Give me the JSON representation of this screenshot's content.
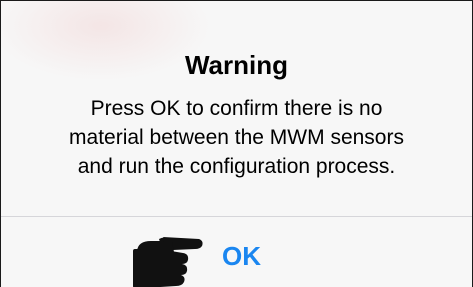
{
  "alert": {
    "title": "Warning",
    "message_lines": [
      "Press OK to confirm there is no",
      "material between the MWM sensors",
      "and run the configuration process."
    ],
    "ok_label": "OK"
  },
  "icons": {
    "pointer": "pointing-hand-icon"
  },
  "colors": {
    "background": "#f7f7f7",
    "title": "#000000",
    "message": "#000000",
    "divider": "#d6d6da",
    "ok_text": "#1a86f0",
    "pointer": "#111111"
  }
}
